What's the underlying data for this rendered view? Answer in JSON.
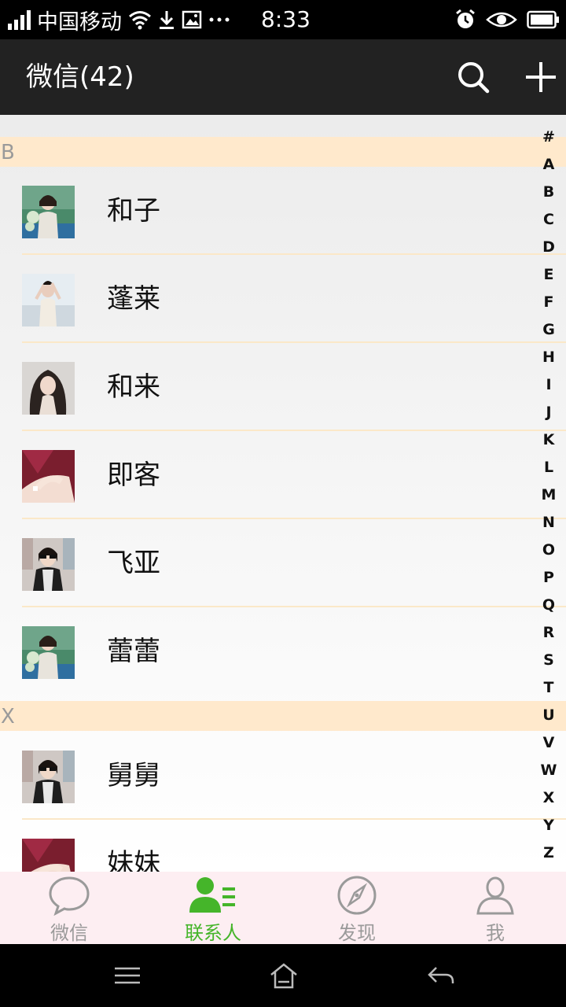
{
  "status_bar": {
    "carrier": "中国移动",
    "time": "8:33",
    "icons": [
      "signal-icon",
      "wifi-icon",
      "download-icon",
      "image-icon",
      "more-icon",
      "alarm-icon",
      "eye-icon",
      "battery-icon"
    ]
  },
  "header": {
    "title": "微信(42)",
    "search_icon": "search-icon",
    "add_icon": "plus-icon"
  },
  "contacts": {
    "sections": [
      {
        "letter": "B",
        "items": [
          {
            "name": "和子",
            "avatar": "avatar-flowers-teal"
          },
          {
            "name": "蓬莱",
            "avatar": "avatar-light-pose"
          },
          {
            "name": "和来",
            "avatar": "avatar-long-hair"
          },
          {
            "name": "即客",
            "avatar": "avatar-hands-red"
          },
          {
            "name": "飞亚",
            "avatar": "avatar-sunglasses"
          },
          {
            "name": "蕾蕾",
            "avatar": "avatar-flowers-teal"
          }
        ]
      },
      {
        "letter": "X",
        "items": [
          {
            "name": "舅舅",
            "avatar": "avatar-sunglasses"
          },
          {
            "name": "妹妹",
            "avatar": "avatar-hands-red"
          }
        ]
      }
    ]
  },
  "alphabet_index": [
    "#",
    "A",
    "B",
    "C",
    "D",
    "E",
    "F",
    "G",
    "H",
    "I",
    "J",
    "K",
    "L",
    "M",
    "N",
    "O",
    "P",
    "Q",
    "R",
    "S",
    "T",
    "U",
    "V",
    "W",
    "X",
    "Y",
    "Z"
  ],
  "tabs": [
    {
      "label": "微信",
      "icon": "chat-bubble-icon",
      "active": false
    },
    {
      "label": "联系人",
      "icon": "contacts-icon",
      "active": true
    },
    {
      "label": "发现",
      "icon": "compass-icon",
      "active": false
    },
    {
      "label": "我",
      "icon": "person-icon",
      "active": false
    }
  ],
  "colors": {
    "header_bg": "#222222",
    "section_bg": "#ffe9cc",
    "active_tab": "#45b52a",
    "inactive_tab": "#9a9a9a",
    "tabbar_bg": "#fdeef2"
  },
  "nav_bar": {
    "icons": [
      "menu-icon",
      "home-icon",
      "back-icon"
    ]
  }
}
